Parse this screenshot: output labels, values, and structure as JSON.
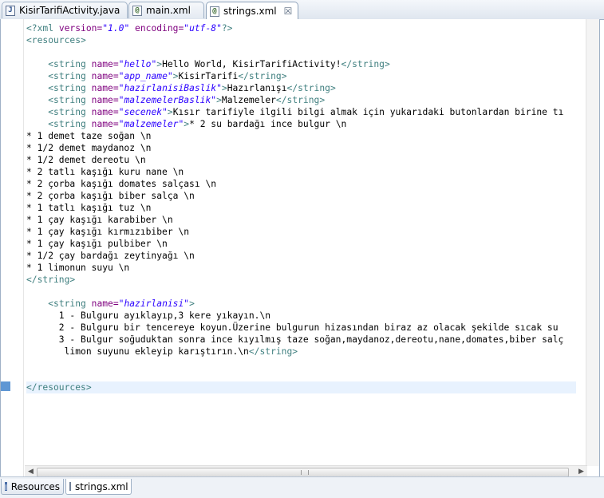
{
  "editor_tabs": [
    {
      "label": "KisirTarifiActivity.java",
      "icon": "java-file-icon",
      "active": false
    },
    {
      "label": "main.xml",
      "icon": "xml-file-icon",
      "active": false
    },
    {
      "label": "strings.xml",
      "icon": "xml-file-icon",
      "active": true,
      "close": "☒"
    }
  ],
  "code": {
    "decl": {
      "open": "<?xml ",
      "a1": "version=",
      "v1": "\"1.0\"",
      "a2": " encoding=",
      "v2": "\"utf-8\"",
      "close": "?>"
    },
    "resources_open": "<resources>",
    "s_hello": {
      "indent": "    ",
      "open": "<string ",
      "attr": "name=",
      "val": "\"hello\"",
      "gt": ">",
      "text": "Hello World, KisirTarifiActivity!",
      "close": "</string>"
    },
    "s_app_name": {
      "indent": "    ",
      "open": "<string ",
      "attr": "name=",
      "val": "\"app_name\"",
      "gt": ">",
      "text": "KisirTarifi",
      "close": "</string>"
    },
    "s_hazirlanisiBaslik": {
      "indent": "    ",
      "open": "<string ",
      "attr": "name=",
      "val": "\"hazirlanisiBaslik\"",
      "gt": ">",
      "text": "Hazırlanışı",
      "close": "</string>"
    },
    "s_malzemelerBaslik": {
      "indent": "    ",
      "open": "<string ",
      "attr": "name=",
      "val": "\"malzemelerBaslik\"",
      "gt": ">",
      "text": "Malzemeler",
      "close": "</string>"
    },
    "s_secenek": {
      "indent": "    ",
      "open": "<string ",
      "attr": "name=",
      "val": "\"secenek\"",
      "gt": ">",
      "text": "Kısır tarifiyle ilgili bilgi almak için yukarıdaki butonlardan birine tı"
    },
    "s_malzemeler": {
      "indent": "    ",
      "open": "<string ",
      "attr": "name=",
      "val": "\"malzemeler\"",
      "gt": ">",
      "text": "* 2 su bardağı ince bulgur \\n"
    },
    "malzeme_lines": [
      "* 1 demet taze soğan \\n",
      "* 1/2 demet maydanoz \\n",
      "* 1/2 demet dereotu \\n",
      "* 2 tatlı kaşığı kuru nane \\n",
      "* 2 çorba kaşığı domates salçası \\n",
      "* 2 çorba kaşığı biber salça \\n",
      "* 1 tatlı kaşığı tuz \\n",
      "* 1 çay kaşığı karabiber \\n",
      "* 1 çay kaşığı kırmızıbiber \\n",
      "* 1 çay kaşığı pulbiber \\n",
      "* 1/2 çay bardağı zeytinyağı \\n",
      "* 1 limonun suyu \\n"
    ],
    "string_close": "</string>",
    "s_hazirlanisi": {
      "indent": "    ",
      "open": "<string ",
      "attr": "name=",
      "val": "\"hazirlanisi\"",
      "gt": ">"
    },
    "hazirlanisi_lines": [
      "      1 - Bulguru ayıklayıp,3 kere yıkayın.\\n",
      "      2 - Bulguru bir tencereye koyun.Üzerine bulgurun hizasından biraz az olacak şekilde sıcak su",
      "      3 - Bulgur soğuduktan sonra ince kıyılmış taze soğan,maydanoz,dereotu,nane,domates,biber salç"
    ],
    "hazirlanisi_last": {
      "text": "       limon suyunu ekleyip karıştırın.\\n",
      "close": "</string>"
    },
    "resources_close": "</resources>"
  },
  "bottom_tabs": [
    {
      "label": "Resources",
      "icon": "resources-form-icon",
      "active": false
    },
    {
      "label": "strings.xml",
      "icon": "xml-source-icon",
      "active": true
    }
  ],
  "colors": {
    "tag": "#3f7f7f",
    "attr": "#7f007f",
    "value": "#2a00ff",
    "current_line": "#e8f2fe"
  }
}
